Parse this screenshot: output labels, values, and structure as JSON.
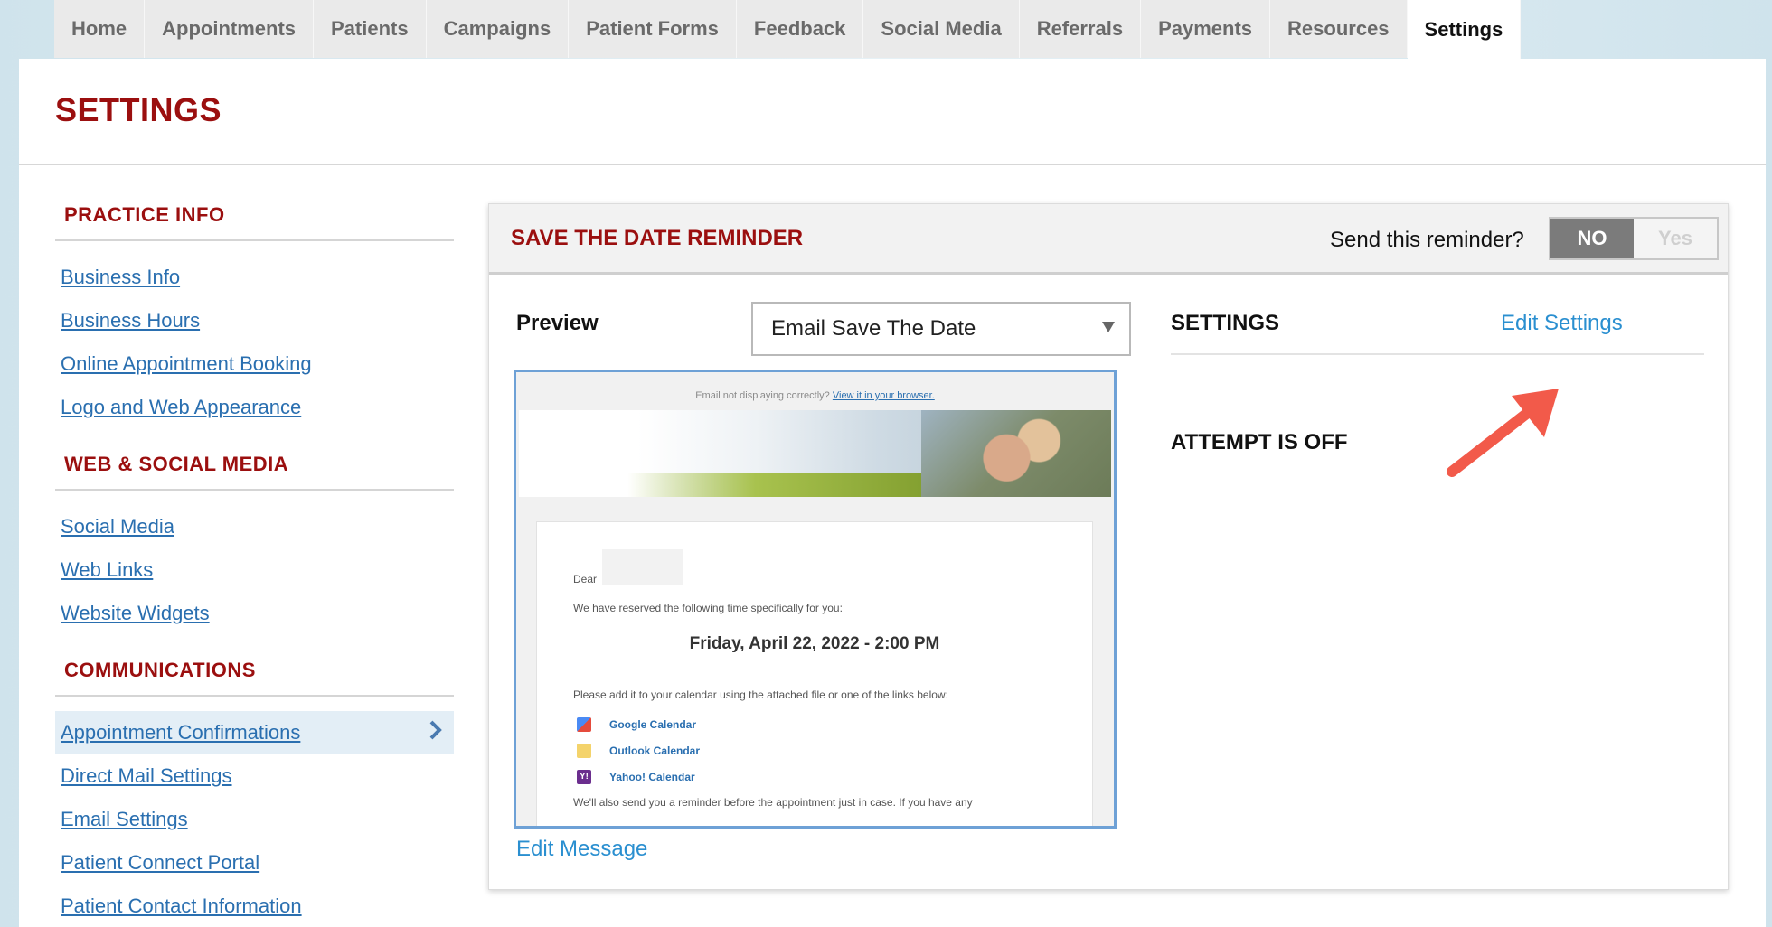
{
  "nav": {
    "tabs": [
      {
        "label": "Home"
      },
      {
        "label": "Appointments"
      },
      {
        "label": "Patients"
      },
      {
        "label": "Campaigns"
      },
      {
        "label": "Patient Forms"
      },
      {
        "label": "Feedback"
      },
      {
        "label": "Social Media"
      },
      {
        "label": "Referrals"
      },
      {
        "label": "Payments"
      },
      {
        "label": "Resources"
      },
      {
        "label": "Settings"
      }
    ],
    "active": "Settings"
  },
  "page": {
    "title": "SETTINGS"
  },
  "sidebar": {
    "sections": [
      {
        "heading": "PRACTICE INFO",
        "items": [
          "Business Info",
          "Business Hours",
          "Online Appointment Booking",
          "Logo and Web Appearance"
        ]
      },
      {
        "heading": "WEB & SOCIAL MEDIA",
        "items": [
          "Social Media",
          "Web Links",
          "Website Widgets"
        ]
      },
      {
        "heading": "COMMUNICATIONS",
        "items": [
          "Appointment Confirmations",
          "Direct Mail Settings",
          "Email Settings",
          "Patient Connect Portal",
          "Patient Contact Information"
        ]
      }
    ],
    "active_item": "Appointment Confirmations",
    "active_icon": "chevron-right-icon"
  },
  "reminder": {
    "title": "SAVE THE DATE REMINDER",
    "send_question": "Send this reminder?",
    "toggle_no": "NO",
    "toggle_yes": "Yes",
    "toggle_selected": "NO"
  },
  "preview": {
    "label": "Preview",
    "select_value": "Email Save The Date",
    "edit_message": "Edit Message",
    "email": {
      "top_text": "Email not displaying correctly?",
      "top_link": "View it in your browser.",
      "dear": "Dear",
      "reserved": "We have reserved the following time specifically for you:",
      "appointment": "Friday, April 22, 2022 - 2:00 PM",
      "add_calendar": "Please add it to your calendar using the attached file or one of the links below:",
      "calendars": [
        "Google Calendar",
        "Outlook Calendar",
        "Yahoo! Calendar"
      ],
      "also": "We'll also send you a reminder before the appointment just in case. If you have any"
    }
  },
  "settings_panel": {
    "label": "SETTINGS",
    "edit_settings": "Edit Settings",
    "status": "ATTEMPT IS OFF"
  },
  "colors": {
    "brand_red": "#9b0f0f",
    "link_blue": "#2a6fb0",
    "action_blue": "#2a8fd0",
    "annotation_arrow": "#f25a4a"
  }
}
